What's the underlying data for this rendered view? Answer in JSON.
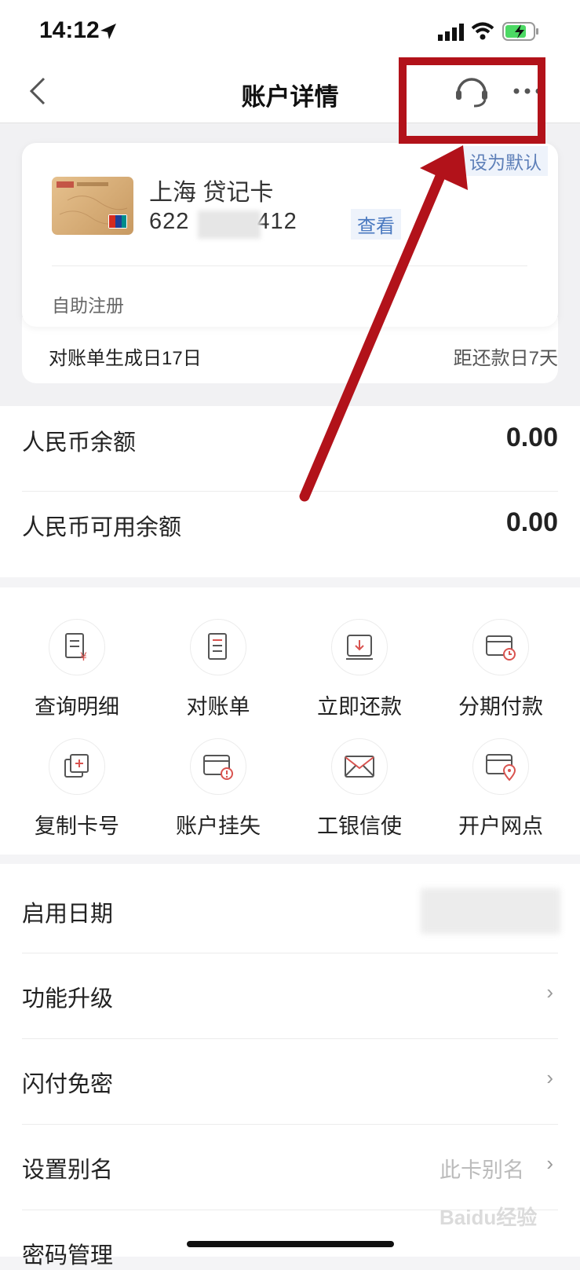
{
  "status_bar": {
    "time": "14:12"
  },
  "header": {
    "title": "账户详情"
  },
  "card": {
    "set_default": "设为默认",
    "name": "上海 贷记卡",
    "number_start": "622",
    "number_end": "412",
    "view": "查看",
    "self_register": "自助注册",
    "bill_day": "对账单生成日17日",
    "due_day": "距还款日7天"
  },
  "balances": [
    {
      "label": "人民币余额",
      "value": "0.00"
    },
    {
      "label": "人民币可用余额",
      "value": "0.00"
    }
  ],
  "actions": [
    {
      "label": "查询明细",
      "icon": "statement-yuan-icon"
    },
    {
      "label": "对账单",
      "icon": "bill-icon"
    },
    {
      "label": "立即还款",
      "icon": "repay-download-icon"
    },
    {
      "label": "分期付款",
      "icon": "installment-clock-icon"
    },
    {
      "label": "复制卡号",
      "icon": "copy-plus-icon"
    },
    {
      "label": "账户挂失",
      "icon": "card-warning-icon"
    },
    {
      "label": "工银信使",
      "icon": "envelope-icon"
    },
    {
      "label": "开户网点",
      "icon": "card-location-icon"
    }
  ],
  "settings": [
    {
      "label": "启用日期"
    },
    {
      "label": "功能升级"
    },
    {
      "label": "闪付免密"
    },
    {
      "label": "设置别名",
      "value": "此卡别名"
    },
    {
      "label": "密码管理"
    }
  ],
  "watermark": "Baidu经验",
  "colors": {
    "accent": "#4a79c0",
    "annotation": "#b2121a",
    "icon_red": "#d9534f"
  }
}
